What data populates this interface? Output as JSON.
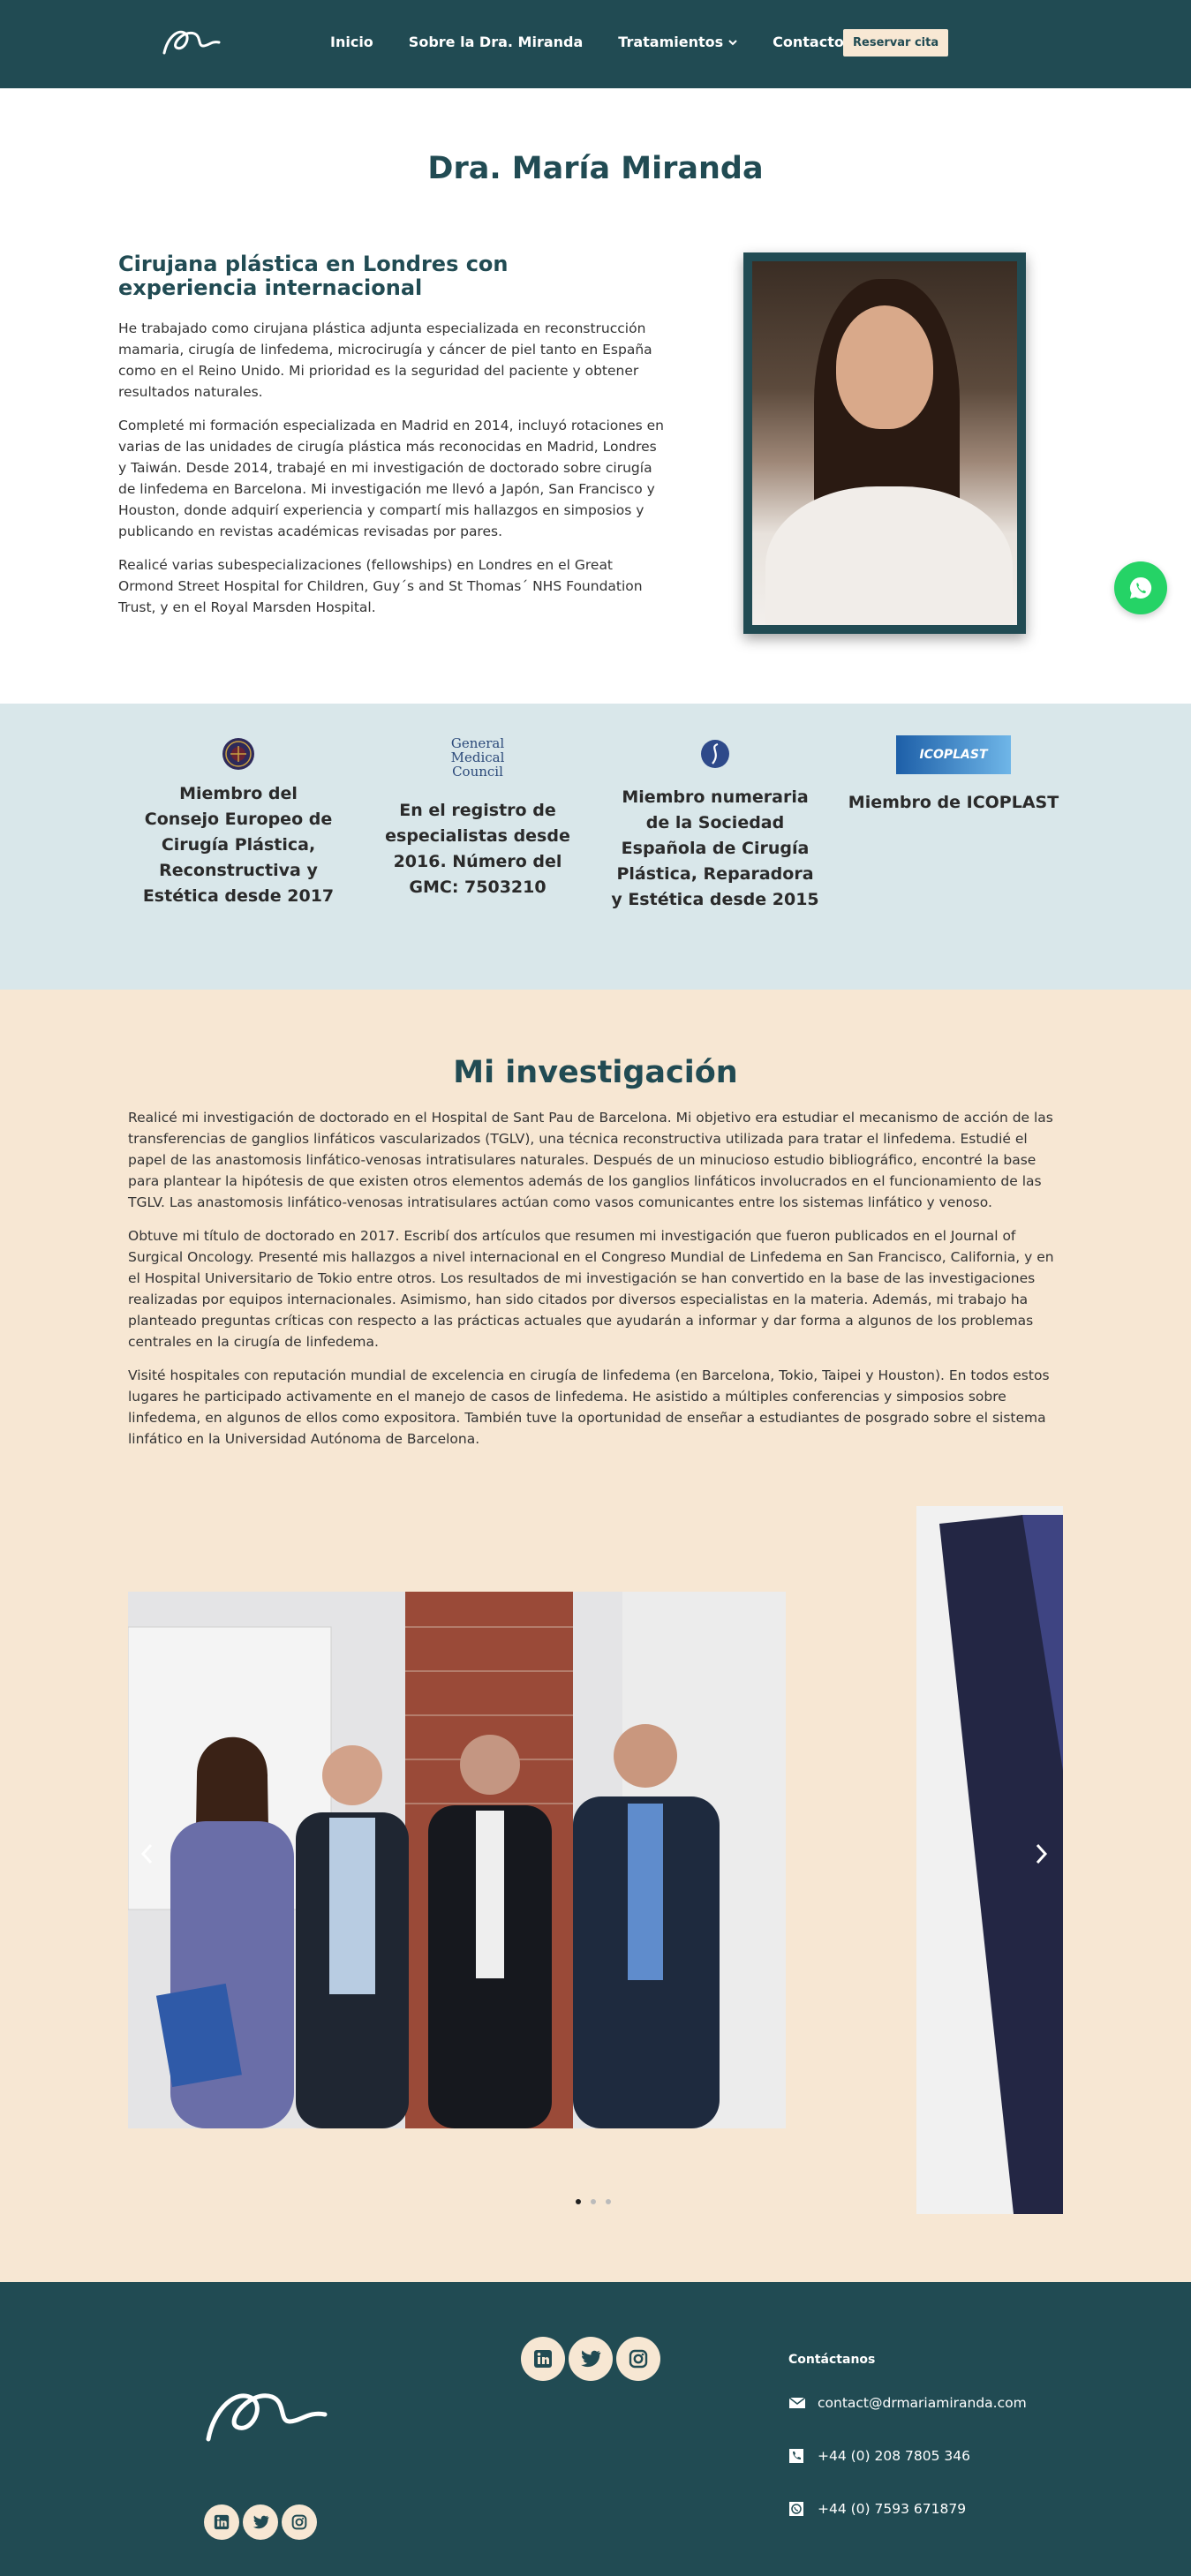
{
  "header": {
    "nav": [
      "Inicio",
      "Sobre la Dra. Miranda",
      "Tratamientos",
      "Contacto"
    ],
    "book_label": "Reservar cita"
  },
  "bio": {
    "title": "Dra. María Miranda",
    "subtitle": "Cirujana plástica en Londres con experiencia internacional",
    "paragraphs": [
      "He trabajado como cirujana plástica adjunta especializada en reconstrucción mamaria, cirugía de linfedema, microcirugía y cáncer de piel tanto en España como en el Reino Unido. Mi prioridad es la seguridad del paciente y obtener resultados naturales.",
      "Completé mi formación especializada en Madrid en 2014, incluyó rotaciones en varias de las unidades de cirugía plástica más reconocidas en Madrid, Londres y Taiwán. Desde 2014, trabajé en mi investigación de doctorado sobre cirugía de linfedema en Barcelona. Mi investigación me llevó a Japón, San Francisco y Houston, donde adquirí experiencia y compartí mis hallazgos en simposios y publicando en revistas académicas revisadas por pares.",
      "Realicé varias subespecializaciones (fellowships) en Londres en el Great Ormond Street Hospital for Children, Guy´s and St Thomas´ NHS Foundation Trust, y en el Royal Marsden Hospital."
    ]
  },
  "memberships": [
    {
      "text": "Miembro del Consejo Europeo de Cirugía Plástica, Reconstructiva y Estética desde 2017",
      "icon": "ebopras-seal-icon"
    },
    {
      "text": "En el registro de especialistas desde 2016. Número del GMC: 7503210",
      "icon": "gmc-logo",
      "logo_lines": [
        "General",
        "Medical",
        "Council"
      ]
    },
    {
      "text": "Miembro numeraria de la Sociedad Española de Cirugía Plástica, Reparadora y Estética desde 2015",
      "icon": "secpre-logo"
    },
    {
      "text": "Miembro de ICOPLAST",
      "icon": "icoplast-logo",
      "logo_text": "ICOPLAST"
    }
  ],
  "research": {
    "title": "Mi investigación",
    "paragraphs": [
      "Realicé mi investigación de doctorado en el Hospital de Sant Pau de Barcelona. Mi objetivo era estudiar el mecanismo de acción de las transferencias de ganglios linfáticos vascularizados (TGLV), una técnica reconstructiva utilizada para tratar el linfedema. Estudié el papel de las anastomosis linfático-venosas intratisulares naturales. Después de un minucioso estudio bibliográfico, encontré la base para plantear la hipótesis de que existen otros elementos además de los ganglios linfáticos involucrados en el funcionamiento de las TGLV. Las anastomosis linfático-venosas intratisulares actúan como vasos comunicantes entre los sistemas linfático y venoso.",
      "Obtuve mi título de doctorado en 2017. Escribí dos artículos que resumen mi investigación que fueron publicados en el Journal of Surgical Oncology. Presenté mis hallazgos a nivel internacional en el Congreso Mundial de Linfedema en San Francisco, California, y en el Hospital Universitario de Tokio entre otros. Los resultados de mi investigación se han convertido en la base de las investigaciones realizadas por equipos internacionales. Asimismo, han sido citados por diversos especialistas en la materia. Además, mi trabajo ha planteado preguntas críticas con respecto a las prácticas actuales que ayudarán a informar y dar forma a algunos de los problemas centrales en la cirugía de linfedema.",
      "Visité hospitales con reputación mundial de excelencia en cirugía de linfedema (en Barcelona, Tokio, Taipei y Houston). En todos estos lugares he participado activamente en el manejo de casos de linfedema. He asistido a múltiples conferencias y simposios sobre linfedema, en algunos de ellos como expositora. También tuve la oportunidad de enseñar a estudiantes de posgrado sobre el sistema linfático en la Universidad Autónoma de Barcelona."
    ],
    "carousel_dots": 3,
    "active_dot": 0
  },
  "footer": {
    "contact_title": "Contáctanos",
    "email": "contact@drmariamiranda.com",
    "phone": "+44 (0) 208 7805 346",
    "whatsapp": "+44 (0) 7593 671879",
    "social": [
      "linkedin-icon",
      "twitter-icon",
      "instagram-icon"
    ]
  },
  "colors": {
    "primary": "#214b53",
    "cream": "#f7e7d3",
    "light_blue": "#d9e7ea",
    "whatsapp": "#25d366"
  }
}
